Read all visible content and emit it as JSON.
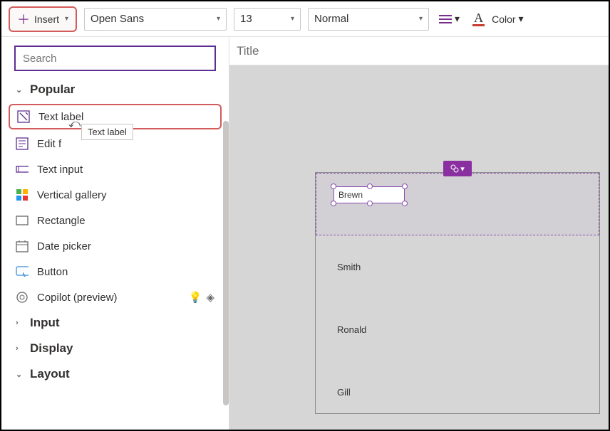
{
  "toolbar": {
    "insert_label": "Insert",
    "font": "Open Sans",
    "size": "13",
    "weight": "Normal",
    "color_label": "Color"
  },
  "panel": {
    "search_placeholder": "Search",
    "groups": {
      "popular": "Popular",
      "input": "Input",
      "display": "Display",
      "layout": "Layout"
    },
    "items": {
      "text_label": "Text label",
      "edit_form": "Edit f",
      "text_input": "Text input",
      "vertical_gallery": "Vertical gallery",
      "rectangle": "Rectangle",
      "date_picker": "Date picker",
      "button": "Button",
      "copilot": "Copilot (preview)"
    },
    "tooltip": "Text label"
  },
  "canvas": {
    "title": "Title",
    "rows": [
      "Brewn",
      "Smith",
      "Ronald",
      "Gill"
    ]
  },
  "colors": {
    "accent": "#8a2fa0",
    "highlight_border": "#d45b5b"
  }
}
